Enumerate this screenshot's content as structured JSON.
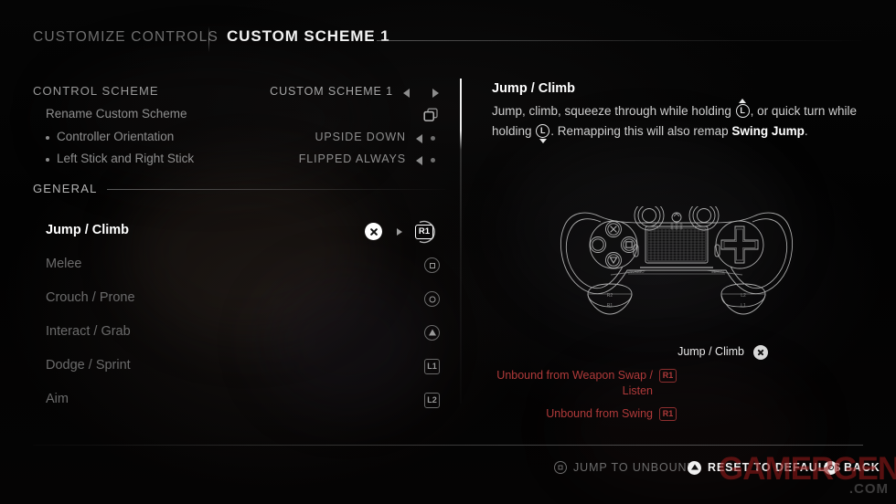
{
  "header": {
    "tab_inactive": "CUSTOMIZE CONTROLS",
    "tab_active": "CUSTOM SCHEME 1"
  },
  "scheme_section": {
    "rows": [
      {
        "label": "CONTROL SCHEME",
        "value": "CUSTOM SCHEME 1",
        "control": "arrows"
      },
      {
        "label": "Rename Custom Scheme",
        "value": "",
        "control": "copy-icon"
      },
      {
        "label": "Controller Orientation",
        "value": "UPSIDE DOWN",
        "control": "arrow-dot"
      },
      {
        "label": "Left Stick and Right Stick",
        "value": "FLIPPED ALWAYS",
        "control": "arrow-dot"
      }
    ]
  },
  "general_section": {
    "title": "GENERAL",
    "bindings": [
      {
        "name": "Jump / Climb",
        "button": "cross",
        "selected": true,
        "pending": "R1"
      },
      {
        "name": "Melee",
        "button": "square",
        "selected": false
      },
      {
        "name": "Crouch / Prone",
        "button": "circle",
        "selected": false
      },
      {
        "name": "Interact / Grab",
        "button": "triangle",
        "selected": false
      },
      {
        "name": "Dodge / Sprint",
        "button": "L1",
        "selected": false
      },
      {
        "name": "Aim",
        "button": "L2",
        "selected": false
      }
    ]
  },
  "detail": {
    "title": "Jump / Climb",
    "desc_part1": "Jump, climb, squeeze through while holding ",
    "stick1": {
      "icon": "left-stick-up-icon",
      "letter": "L",
      "direction": "up"
    },
    "desc_part2": ", or quick turn while holding ",
    "stick2": {
      "icon": "left-stick-down-icon",
      "letter": "L",
      "direction": "down"
    },
    "desc_part3": ". Remapping this will also remap ",
    "desc_bold": "Swing Jump",
    "desc_part4": ".",
    "controller_icon": "ps4-dualshock-wireframe-upside-down"
  },
  "legend": {
    "rows": [
      {
        "text": "Jump / Climb",
        "icon": "cross-button-icon",
        "badge": "",
        "state": "ok"
      },
      {
        "text": "Unbound from Weapon Swap /\nListen",
        "icon": "",
        "badge": "R1",
        "state": "warning"
      },
      {
        "text": "Unbound from Swing",
        "icon": "",
        "badge": "R1",
        "state": "warning"
      }
    ]
  },
  "footer": {
    "actions": [
      {
        "label": "JUMP TO UNBOUND",
        "icon": "square-button-icon",
        "state": "dim"
      },
      {
        "label": "RESET TO DEFAULTS",
        "icon": "triangle-button-icon",
        "state": "lit"
      },
      {
        "label": "BACK",
        "icon": "circle-button-icon",
        "state": "lit"
      }
    ]
  },
  "watermark": {
    "main": "GAMERGEN",
    "sub": ".COM"
  },
  "colors": {
    "background": "#030303",
    "text_primary": "#ffffff",
    "text_dim": "#6b6b6b",
    "warning_red": "#b03a3a",
    "accent_white": "#f0f0f0"
  }
}
